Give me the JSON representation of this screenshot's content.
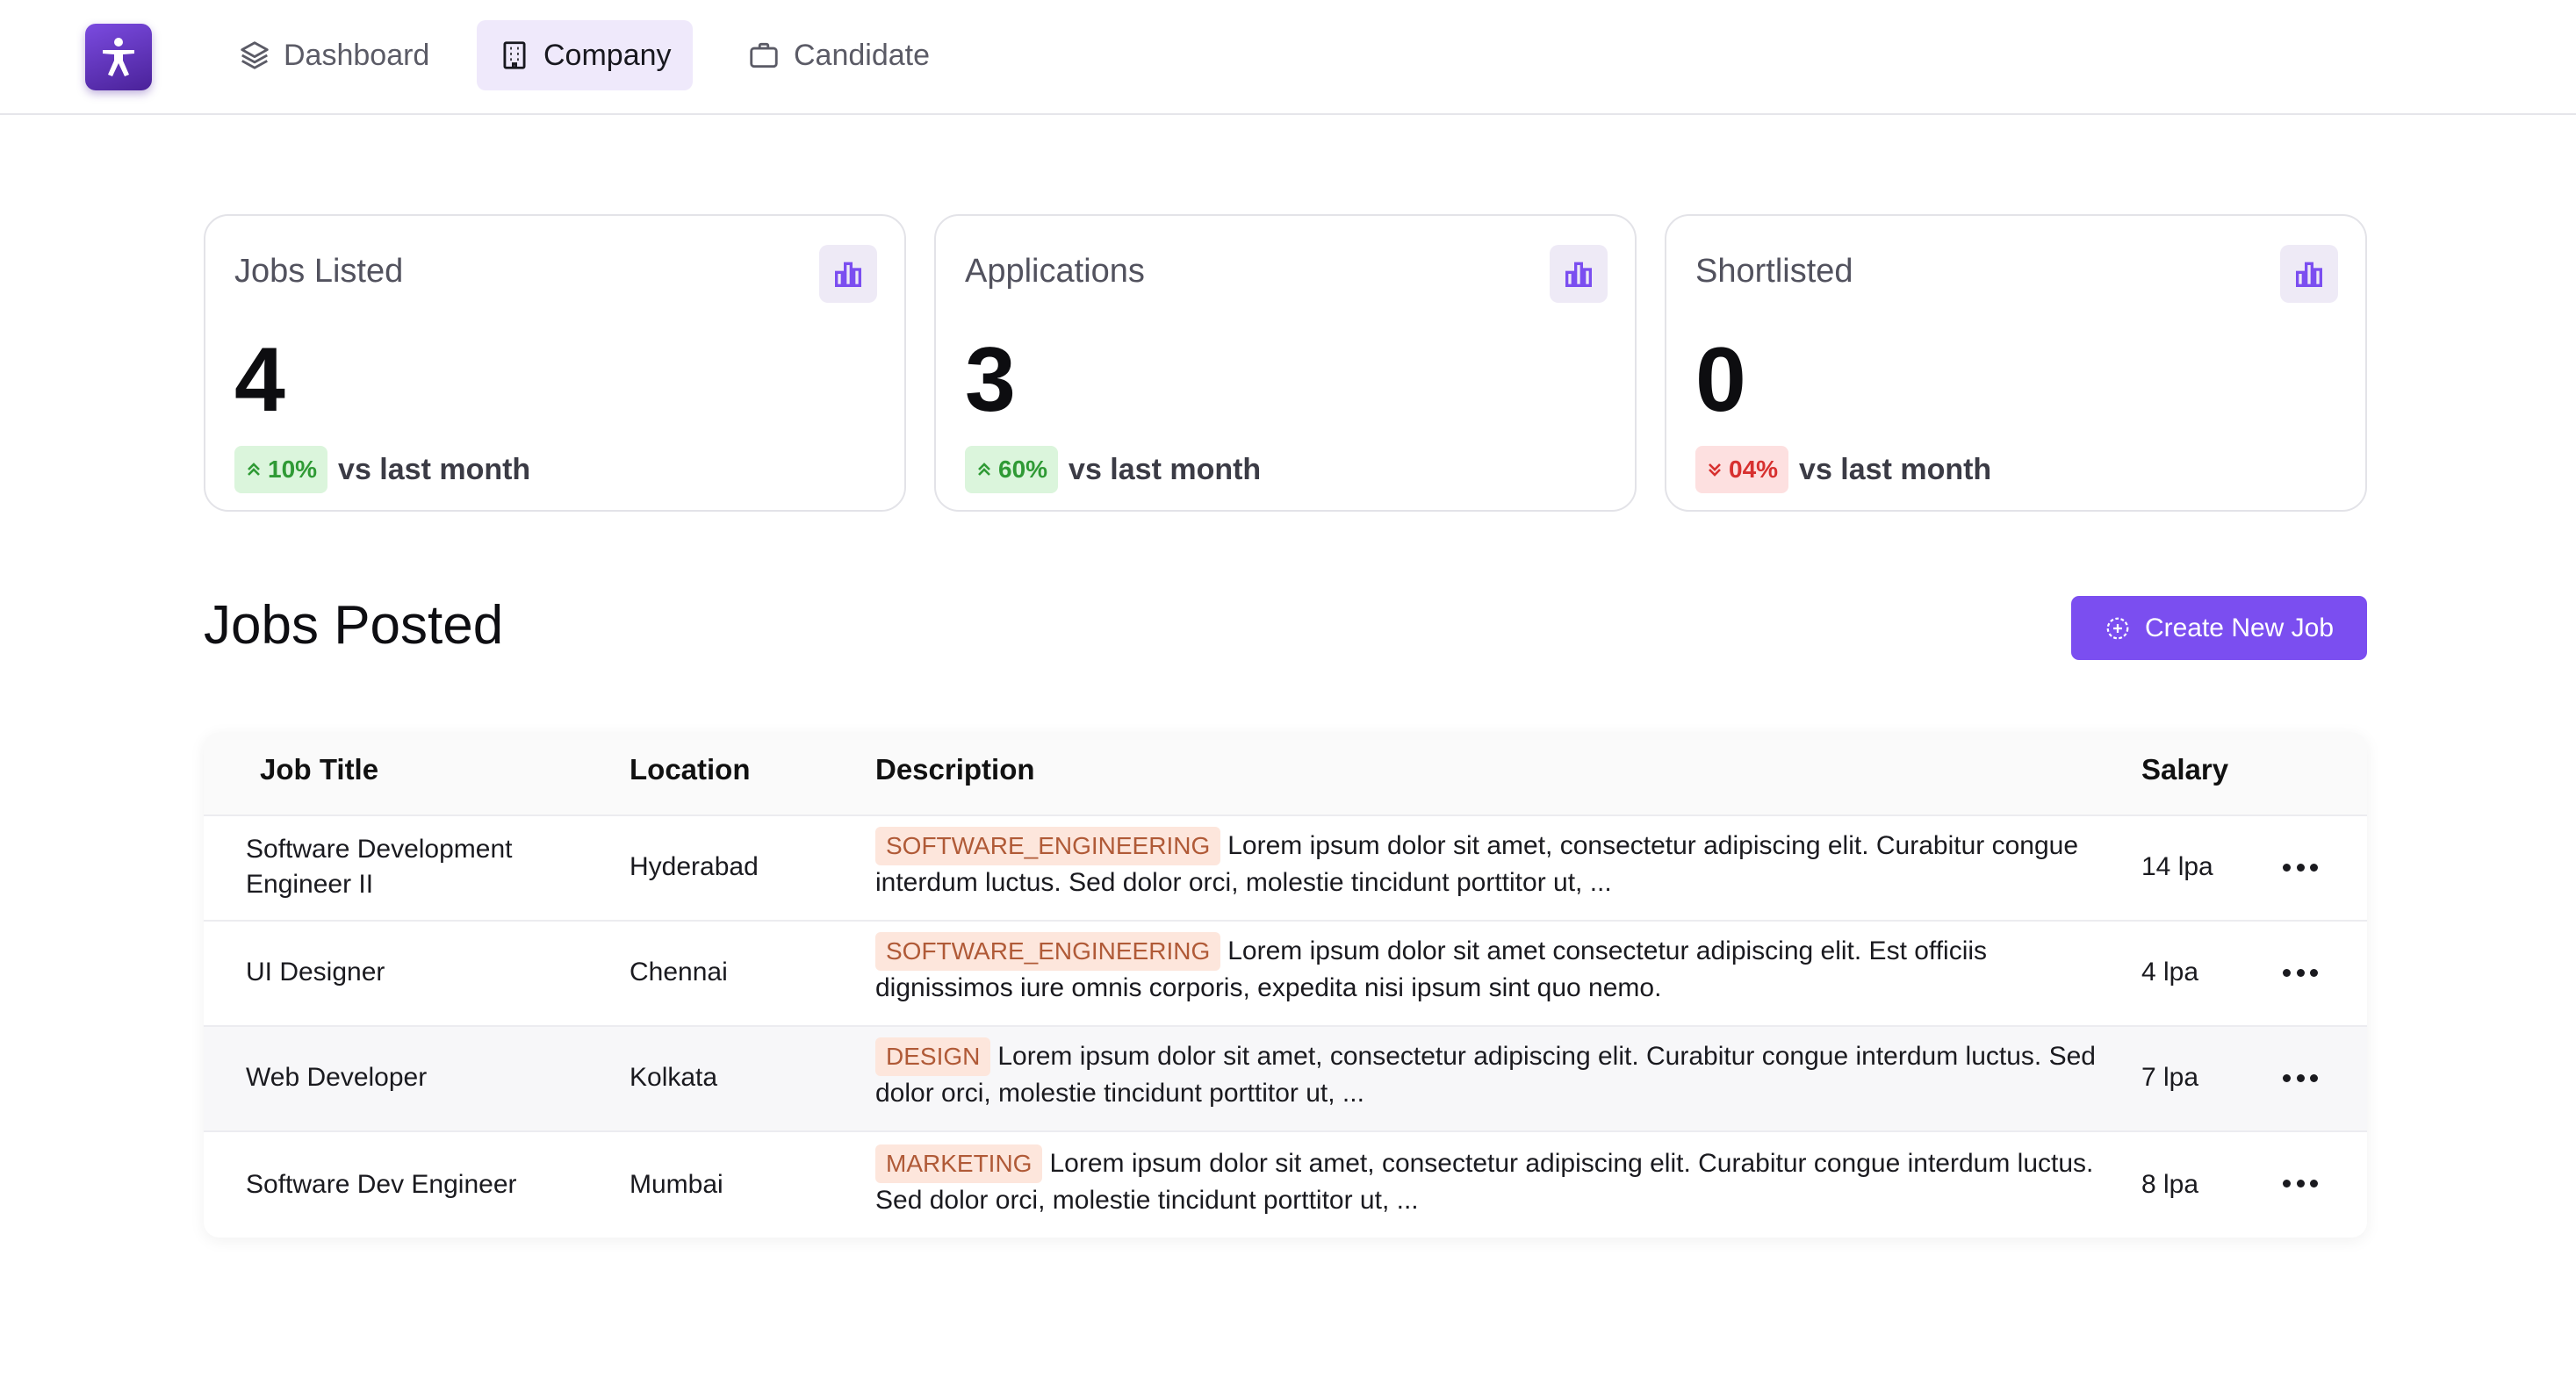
{
  "nav": {
    "items": [
      {
        "label": "Dashboard",
        "icon": "layers-icon",
        "active": false
      },
      {
        "label": "Company",
        "icon": "building-icon",
        "active": true
      },
      {
        "label": "Candidate",
        "icon": "briefcase-icon",
        "active": false
      }
    ]
  },
  "stats": [
    {
      "title": "Jobs Listed",
      "value": "4",
      "trend": "10%",
      "direction": "up",
      "foot": "vs last month"
    },
    {
      "title": "Applications",
      "value": "3",
      "trend": "60%",
      "direction": "up",
      "foot": "vs last month"
    },
    {
      "title": "Shortlisted",
      "value": "0",
      "trend": "04%",
      "direction": "down",
      "foot": "vs last month"
    }
  ],
  "section": {
    "title": "Jobs Posted",
    "create_label": "Create New Job"
  },
  "table": {
    "headers": [
      "Job Title",
      "Location",
      "Description",
      "Salary"
    ],
    "rows": [
      {
        "title": "Software Development Engineer II",
        "location": "Hyderabad",
        "tag": "SOFTWARE_ENGINEERING",
        "description": "Lorem ipsum dolor sit amet, consectetur adipiscing elit. Curabitur congue interdum luctus. Sed dolor orci, molestie tincidunt porttitor ut, ...",
        "salary": "14 lpa"
      },
      {
        "title": "UI Designer",
        "location": "Chennai",
        "tag": "SOFTWARE_ENGINEERING",
        "description": "Lorem ipsum dolor sit amet consectetur adipiscing elit. Est officiis dignissimos iure omnis corporis, expedita nisi ipsum sint quo nemo.",
        "salary": "4 lpa"
      },
      {
        "title": "Web Developer",
        "location": "Kolkata",
        "tag": "DESIGN",
        "description": "Lorem ipsum dolor sit amet, consectetur adipiscing elit. Curabitur congue interdum luctus. Sed dolor orci, molestie tincidunt porttitor ut, ...",
        "salary": "7 lpa"
      },
      {
        "title": "Software Dev Engineer",
        "location": "Mumbai",
        "tag": "MARKETING",
        "description": "Lorem ipsum dolor sit amet, consectetur adipiscing elit. Curabitur congue interdum luctus. Sed dolor orci, molestie tincidunt porttitor ut, ...",
        "salary": "8 lpa"
      }
    ]
  },
  "colors": {
    "accent": "#7b4ef0",
    "up": "#2f9a35",
    "down": "#d7302f",
    "tag_bg": "#fde6dc",
    "tag_text": "#b05a37"
  }
}
